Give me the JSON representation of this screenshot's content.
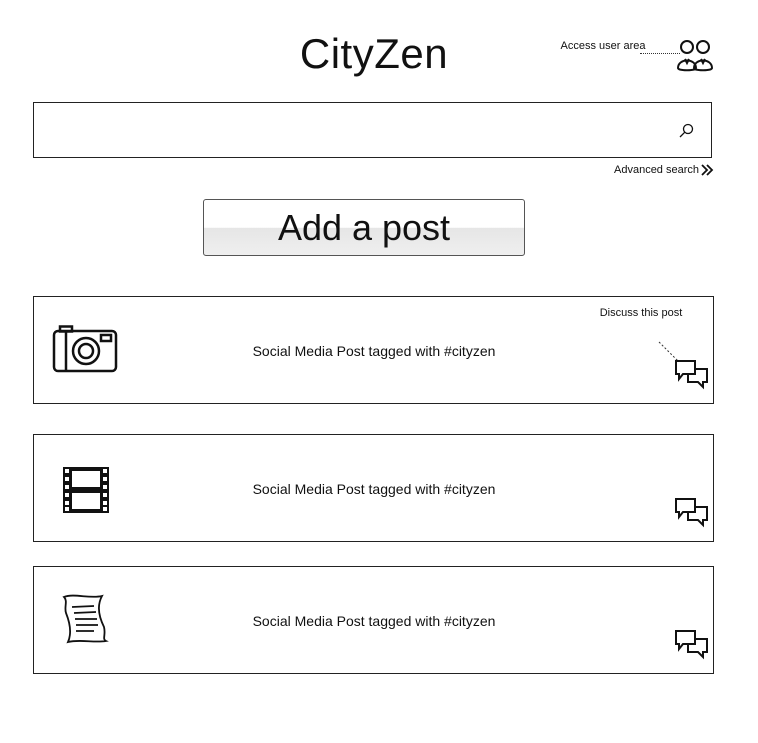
{
  "header": {
    "title": "CityZen",
    "user_area_label": "Access user area"
  },
  "search": {
    "value": "",
    "placeholder": "",
    "advanced_label": "Advanced search"
  },
  "actions": {
    "add_post_label": "Add a post"
  },
  "posts": [
    {
      "media": "camera-icon",
      "text": "Social Media Post tagged with #cityzen",
      "discuss_label": "Discuss this post"
    },
    {
      "media": "film-icon",
      "text": "Social Media Post tagged with #cityzen"
    },
    {
      "media": "document-icon",
      "text": "Social Media Post tagged with #cityzen"
    }
  ],
  "colors": {
    "ink": "#111111",
    "border": "#222222",
    "button_face": "#e6e6e6"
  }
}
